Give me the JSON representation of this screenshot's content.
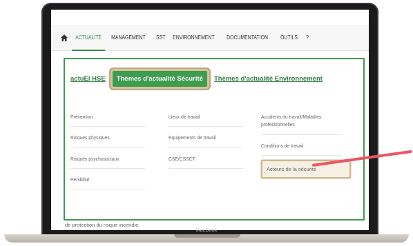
{
  "nav": {
    "items": [
      "ACTUALITÉ",
      "MANAGEMENT",
      "SST",
      "ENVIRONNEMENT",
      "DOCUMENTATION",
      "OUTILS",
      "?"
    ],
    "active_index": 0
  },
  "tabs": {
    "left_link": "actuEl HSE",
    "selected": "Thèmes d'actualité Sécurité",
    "right_link": "Thèmes d'actualité Environnement"
  },
  "columns": [
    [
      "Prévention",
      "Risques physiques",
      "Risques psychosociaux",
      "Pénibilité"
    ],
    [
      "Lieux de travail",
      "Equipements de travail",
      "CSE/CSSCT"
    ],
    [
      "Accidents du travail/Maladies professionnelles",
      "Conditions de travail",
      "Acteurs de la sécurité"
    ]
  ],
  "footnote": "de protection du risque incendie.",
  "device_label": "MacBook",
  "colors": {
    "accent": "#3e9c4f",
    "highlight_border": "#cfb88d",
    "pointer": "#ee5560"
  }
}
